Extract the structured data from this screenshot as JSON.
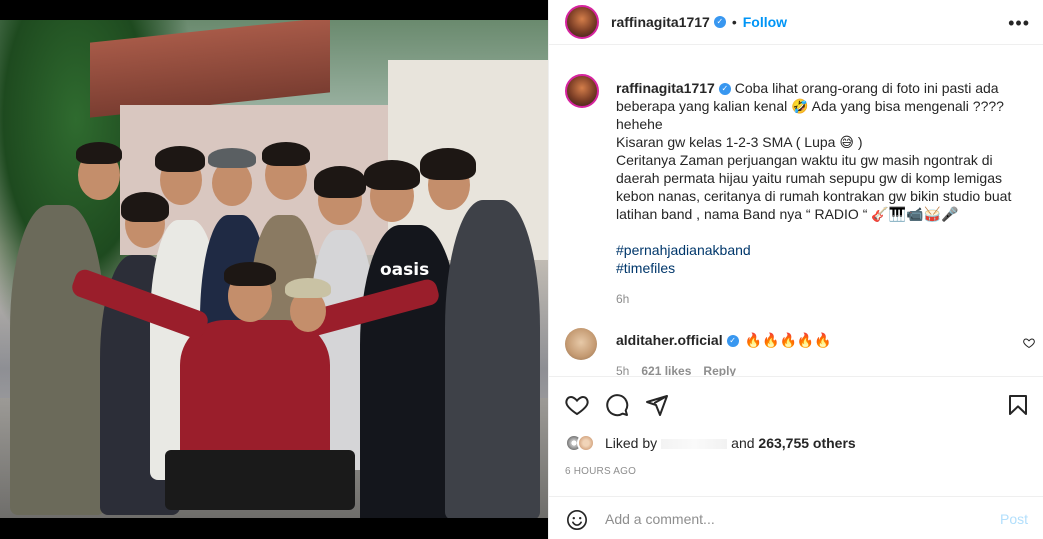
{
  "post": {
    "username": "raffinagita1717",
    "follow_label": "Follow",
    "dot": "•",
    "more_label": "•••",
    "caption": "Coba lihat orang-orang di foto ini pasti ada beberapa yang kalian kenal 🤣 Ada yang bisa mengenali ????\nhehehe\nKisaran gw kelas 1-2-3 SMA ( Lupa 😅 )\nCeritanya Zaman perjuangan waktu itu gw masih ngontrak di daerah permata hijau yaitu rumah sepupu gw di komp lemigas kebon nanas, ceritanya di rumah kontrakan gw bikin studio buat latihan band , nama Band nya “ RADIO “ 🎸🎹📹🥁🎤",
    "hashtags": [
      "#pernahjadianakband",
      "#timefiles"
    ],
    "caption_time": "6h",
    "photo_shirt_text": "oasis"
  },
  "comment": {
    "username": "alditaher.official",
    "text": "🔥🔥🔥🔥🔥",
    "time": "5h",
    "likes": "621 likes",
    "reply": "Reply"
  },
  "likes": {
    "prefix": "Liked by",
    "middle": "and",
    "count": "263,755 others"
  },
  "date": "6 HOURS AGO",
  "add_comment": {
    "placeholder": "Add a comment...",
    "post_label": "Post"
  },
  "colors": {
    "link_blue": "#0095f6",
    "verified": "#3897f0",
    "hashtag": "#00376b",
    "muted": "#8e8e8e"
  }
}
